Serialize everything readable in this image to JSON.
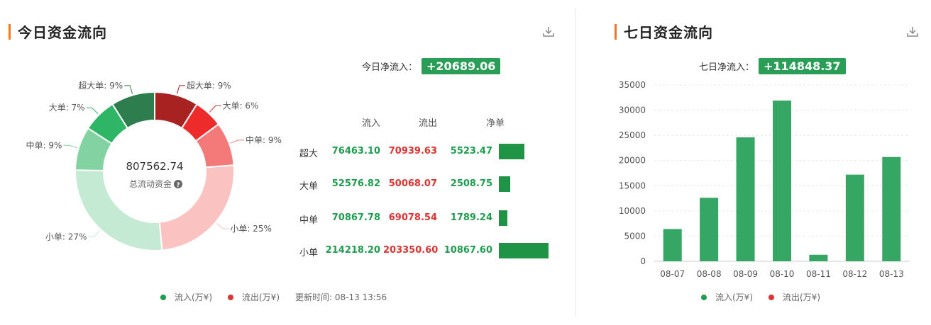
{
  "left": {
    "title": "今日资金流向",
    "net_label": "今日净流入：",
    "net_value": "+20689.06",
    "center_value": "807562.74",
    "center_label": "总流动资金",
    "table_headers": [
      "流入",
      "流出",
      "净单"
    ],
    "rows": [
      {
        "label": "超大",
        "inflow": "76463.10",
        "outflow": "70939.63",
        "net": "5523.47",
        "net_num": 5523.47
      },
      {
        "label": "大单",
        "inflow": "52576.82",
        "outflow": "50068.07",
        "net": "2508.75",
        "net_num": 2508.75
      },
      {
        "label": "中单",
        "inflow": "70867.78",
        "outflow": "69078.54",
        "net": "1789.24",
        "net_num": 1789.24
      },
      {
        "label": "小单",
        "inflow": "214218.20",
        "outflow": "203350.60",
        "net": "10867.60",
        "net_num": 10867.6
      }
    ],
    "legend": {
      "in": "流入(万¥)",
      "out": "流出(万¥)",
      "update": "更新时间: 08-13 13:56"
    }
  },
  "right": {
    "title": "七日资金流向",
    "net_label": "七日净流入：",
    "net_value": "+114848.37",
    "legend": {
      "in": "流入(万¥)",
      "out": "流出(万¥)"
    }
  },
  "colors": {
    "green": "#1f9d4e",
    "red": "#e03232",
    "accent": "#f5761f",
    "bar": "#35a663"
  },
  "chart_data": [
    {
      "type": "pie",
      "title": "",
      "center_text": "807562.74",
      "slices": [
        {
          "label": "超大单: 9%",
          "value": 9,
          "color": "#a82222"
        },
        {
          "label": "大单: 6%",
          "value": 6,
          "color": "#ee2b2b"
        },
        {
          "label": "中单: 9%",
          "value": 9,
          "color": "#f47a7a"
        },
        {
          "label": "小单: 25%",
          "value": 25,
          "color": "#fbc2c2"
        },
        {
          "label": "小单: 27%",
          "value": 27,
          "color": "#c5ead3"
        },
        {
          "label": "中单: 9%",
          "value": 9,
          "color": "#82d3a1"
        },
        {
          "label": "大单: 7%",
          "value": 7,
          "color": "#2fb566"
        },
        {
          "label": "超大单: 9%",
          "value": 9,
          "color": "#2e7d4f"
        }
      ]
    },
    {
      "type": "bar",
      "categories": [
        "08-07",
        "08-08",
        "08-09",
        "08-10",
        "08-11",
        "08-12",
        "08-13"
      ],
      "values": [
        6400,
        12600,
        24600,
        31900,
        1300,
        17200,
        20700
      ],
      "ylim": [
        0,
        35000
      ],
      "yticks": [
        0,
        5000,
        10000,
        15000,
        20000,
        25000,
        30000,
        35000
      ],
      "grid": true
    }
  ]
}
